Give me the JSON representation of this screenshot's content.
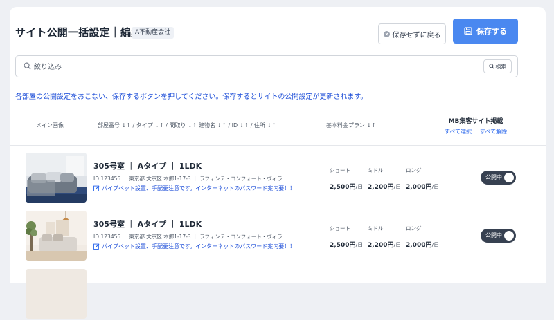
{
  "page": {
    "title": "サイト公開一括設定｜編集",
    "company_badge": "A不動産会社",
    "back_button": "保存せずに戻る",
    "save_button": "保存する"
  },
  "search": {
    "placeholder": "絞り込み",
    "button": "検索"
  },
  "notice": "各部屋の公開設定をおこない、保存するボタンを押してください。保存するとサイトの公開設定が更新されます。",
  "table": {
    "headers": {
      "image": "メイン画像",
      "sort_columns": "部屋番号 ↓↑ / タイプ ↓↑ / 間取り ↓↑ 建物名 ↓↑ / ID ↓↑ / 住所 ↓↑",
      "plan": "基本料金プラン ↓↑",
      "mb_site": "MB集客サイト掲載",
      "select_all": "すべて選択",
      "clear_all": "すべて解除"
    },
    "rows": [
      {
        "room": "305号室 ｜ Aタイプ ｜ 1LDK",
        "meta": "ID:123456 ｜ 東京都 文京区 本郷1-17-3 ｜ ラフォンテ・コンフォート・ヴィラ",
        "note": "パイプペット設置、手配要注意です。インターネットのパスワード案内要！！",
        "plans": [
          {
            "label": "ショート",
            "price": "2,500円",
            "unit": "/日"
          },
          {
            "label": "ミドル",
            "price": "2,200円",
            "unit": "/日"
          },
          {
            "label": "ロング",
            "price": "2,000円",
            "unit": "/日"
          }
        ],
        "status": "公開中"
      },
      {
        "room": "305号室 ｜ Aタイプ ｜ 1LDK",
        "meta": "ID:123456 ｜ 東京都 文京区 本郷1-17-3 ｜ ラフォンテ・コンフォート・ヴィラ",
        "note": "パイプペット設置、手配要注意です。インターネットのパスワード案内要！！",
        "plans": [
          {
            "label": "ショート",
            "price": "2,500円",
            "unit": "/日"
          },
          {
            "label": "ミドル",
            "price": "2,200円",
            "unit": "/日"
          },
          {
            "label": "ロング",
            "price": "2,000円",
            "unit": "/日"
          }
        ],
        "status": "公開中"
      }
    ]
  },
  "colors": {
    "primary": "#4a88f0",
    "link": "#2563eb",
    "toggle_on": "#374151"
  }
}
